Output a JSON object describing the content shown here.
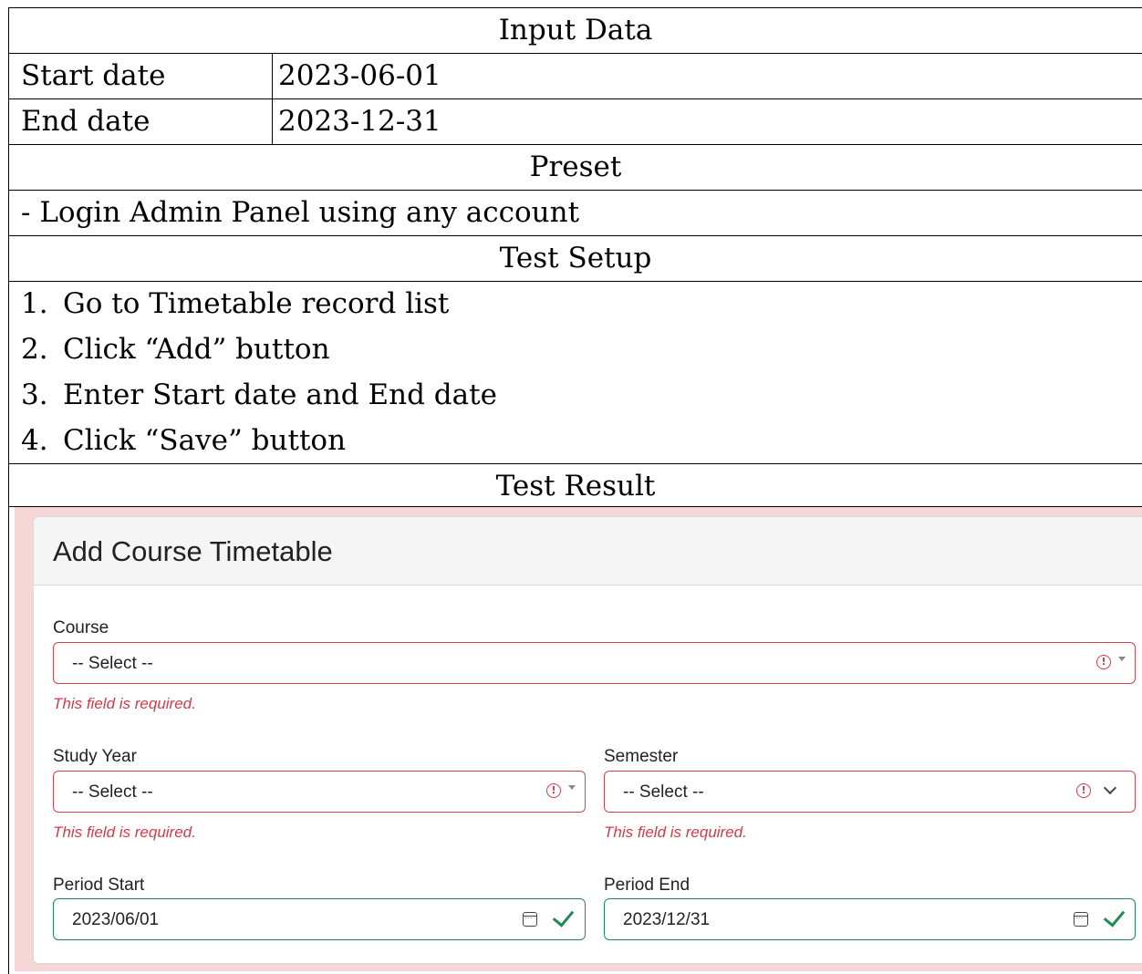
{
  "input_data": {
    "heading": "Input Data",
    "rows": [
      {
        "label": "Start date",
        "value": "2023-06-01"
      },
      {
        "label": "End date",
        "value": "2023-12-31"
      }
    ]
  },
  "preset": {
    "heading": "Preset",
    "text": "- Login Admin Panel using any account"
  },
  "test_setup": {
    "heading": "Test Setup",
    "steps": [
      {
        "num": "1.",
        "text": "Go to Timetable record list"
      },
      {
        "num": "2.",
        "text": "Click “Add” button"
      },
      {
        "num": "3.",
        "text": "Enter Start date and End date"
      },
      {
        "num": "4.",
        "text": "Click “Save” button"
      }
    ]
  },
  "test_result": {
    "heading": "Test Result"
  },
  "form": {
    "title": "Add Course Timetable",
    "course": {
      "label": "Course",
      "value": "-- Select --",
      "error": "This field is required."
    },
    "study_year": {
      "label": "Study Year",
      "value": "-- Select --",
      "error": "This field is required."
    },
    "semester": {
      "label": "Semester",
      "value": "-- Select --",
      "error": "This field is required."
    },
    "period_start": {
      "label": "Period Start",
      "value": "2023/06/01"
    },
    "period_end": {
      "label": "Period End",
      "value": "2023/12/31"
    },
    "icons": {
      "error": "exclamation-circle-icon",
      "valid": "check-icon",
      "date": "calendar-icon"
    },
    "colors": {
      "error": "#d33a47",
      "valid": "#1f8a52",
      "backdrop": "#f6d6d6"
    }
  }
}
